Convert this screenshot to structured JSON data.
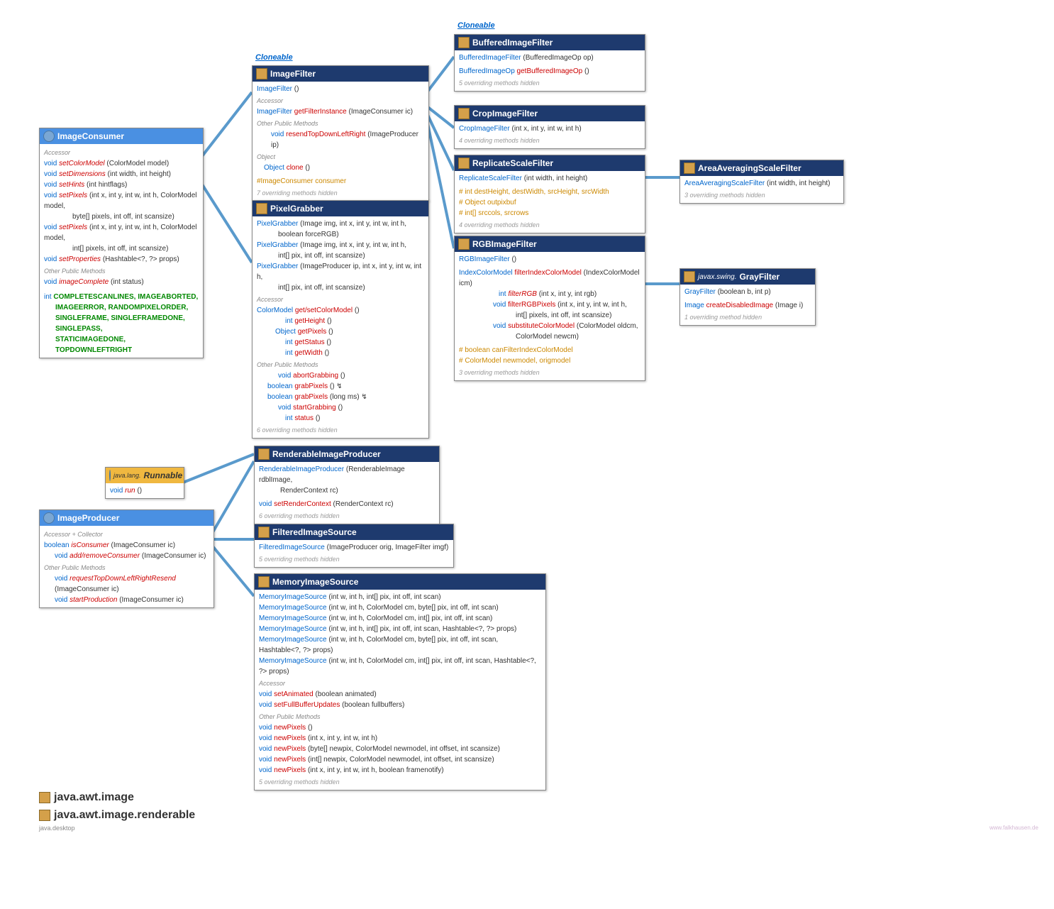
{
  "tags": {
    "cloneable1": "Cloneable",
    "cloneable2": "Cloneable"
  },
  "imageConsumer": {
    "title": "ImageConsumer",
    "sect1": "Accessor",
    "m1r": "void",
    "m1n": "setColorModel",
    "m1p": "(ColorModel model)",
    "m2r": "void",
    "m2n": "setDimensions",
    "m2p": "(int width, int height)",
    "m3r": "void",
    "m3n": "setHints",
    "m3p": "(int hintflags)",
    "m4r": "void",
    "m4n": "setPixels",
    "m4p": "(int x, int y, int w, int h, ColorModel model,",
    "m4p2": "byte[] pixels, int off, int scansize)",
    "m5r": "void",
    "m5n": "setPixels",
    "m5p": "(int x, int y, int w, int h, ColorModel model,",
    "m5p2": "int[] pixels, int off, int scansize)",
    "m6r": "void",
    "m6n": "setProperties",
    "m6p": "(Hashtable<?, ?> props)",
    "sect2": "Other Public Methods",
    "m7r": "void",
    "m7n": "imageComplete",
    "m7p": "(int status)",
    "constr": "int",
    "const1": "COMPLETESCANLINES, IMAGEABORTED,",
    "const2": "IMAGEERROR, RANDOMPIXELORDER,",
    "const3": "SINGLEFRAME, SINGLEFRAMEDONE, SINGLEPASS,",
    "const4": "STATICIMAGEDONE, TOPDOWNLEFTRIGHT"
  },
  "imageFilter": {
    "title": "ImageFilter",
    "c1": "ImageFilter",
    "c1p": "()",
    "s1": "Accessor",
    "m1r": "ImageFilter",
    "m1n": "getFilterInstance",
    "m1p": "(ImageConsumer ic)",
    "s2": "Other Public Methods",
    "m2r": "void",
    "m2n": "resendTopDownLeftRight",
    "m2p": "(ImageProducer ip)",
    "s3": "Object",
    "m3r": "Object",
    "m3n": "clone",
    "m3p": "()",
    "f1": "#ImageConsumer consumer",
    "h": "7 overriding methods hidden"
  },
  "pixelGrabber": {
    "title": "PixelGrabber",
    "c1": "PixelGrabber",
    "c1p": "(Image img, int x, int y, int w, int h,",
    "c1p2": "boolean forceRGB)",
    "c2": "PixelGrabber",
    "c2p": "(Image img, int x, int y, int w, int h,",
    "c2p2": "int[] pix, int off, int scansize)",
    "c3": "PixelGrabber",
    "c3p": "(ImageProducer ip, int x, int y, int w, int h,",
    "c3p2": "int[] pix, int off, int scansize)",
    "s1": "Accessor",
    "m1r": "ColorModel",
    "m1n": "get/setColorModel",
    "m1p": "()",
    "m2r": "int",
    "m2n": "getHeight",
    "m2p": "()",
    "m3r": "Object",
    "m3n": "getPixels",
    "m3p": "()",
    "m4r": "int",
    "m4n": "getStatus",
    "m4p": "()",
    "m5r": "int",
    "m5n": "getWidth",
    "m5p": "()",
    "s2": "Other Public Methods",
    "m6r": "void",
    "m6n": "abortGrabbing",
    "m6p": "()",
    "m7r": "boolean",
    "m7n": "grabPixels",
    "m7p": "() ↯",
    "m8r": "boolean",
    "m8n": "grabPixels",
    "m8p": "(long ms) ↯",
    "m9r": "void",
    "m9n": "startGrabbing",
    "m9p": "()",
    "m10r": "int",
    "m10n": "status",
    "m10p": "()",
    "h": "6 overriding methods hidden"
  },
  "bufferedImageFilter": {
    "title": "BufferedImageFilter",
    "c1": "BufferedImageFilter",
    "c1p": "(BufferedImageOp op)",
    "m1r": "BufferedImageOp",
    "m1n": "getBufferedImageOp",
    "m1p": "()",
    "h": "5 overriding methods hidden"
  },
  "cropImageFilter": {
    "title": "CropImageFilter",
    "c1": "CropImageFilter",
    "c1p": "(int x, int y, int w, int h)",
    "h": "4 overriding methods hidden"
  },
  "replicateScaleFilter": {
    "title": "ReplicateScaleFilter",
    "c1": "ReplicateScaleFilter",
    "c1p": "(int width, int height)",
    "f1": "# int destHeight, destWidth, srcHeight, srcWidth",
    "f2": "# Object outpixbuf",
    "f3": "# int[] srccols, srcrows",
    "h": "4 overriding methods hidden"
  },
  "areaAveragingScaleFilter": {
    "title": "AreaAveragingScaleFilter",
    "c1": "AreaAveragingScaleFilter",
    "c1p": "(int width, int height)",
    "h": "3 overriding methods hidden"
  },
  "rgbImageFilter": {
    "title": "RGBImageFilter",
    "c1": "RGBImageFilter",
    "c1p": "()",
    "m1r": "IndexColorModel",
    "m1n": "filterIndexColorModel",
    "m1p": "(IndexColorModel icm)",
    "m2r": "int",
    "m2n": "filterRGB",
    "m2p": "(int x, int y, int rgb)",
    "m3r": "void",
    "m3n": "filterRGBPixels",
    "m3p": "(int x, int y, int w, int h,",
    "m3p2": "int[] pixels, int off, int scansize)",
    "m4r": "void",
    "m4n": "substituteColorModel",
    "m4p": "(ColorModel oldcm,",
    "m4p2": "ColorModel newcm)",
    "f1": "# boolean canFilterIndexColorModel",
    "f2": "# ColorModel newmodel, origmodel",
    "h": "3 overriding methods hidden"
  },
  "grayFilter": {
    "pkg": "javax.swing.",
    "title": "GrayFilter",
    "c1": "GrayFilter",
    "c1p": "(boolean b, int p)",
    "m1r": "Image",
    "m1n": "createDisabledImage",
    "m1p": "(Image i)",
    "h": "1 overriding method hidden"
  },
  "runnable": {
    "pkg": "java.lang.",
    "title": "Runnable",
    "m1r": "void",
    "m1n": "run",
    "m1p": "()"
  },
  "imageProducer": {
    "title": "ImageProducer",
    "s1": "Accessor + Collector",
    "m1r": "boolean",
    "m1n": "isConsumer",
    "m1p": "(ImageConsumer ic)",
    "m2r": "void",
    "m2n": "add/removeConsumer",
    "m2p": "(ImageConsumer ic)",
    "s2": "Other Public Methods",
    "m3r": "void",
    "m3n": "requestTopDownLeftRightResend",
    "m3p": "(ImageConsumer ic)",
    "m4r": "void",
    "m4n": "startProduction",
    "m4p": "(ImageConsumer ic)"
  },
  "renderableImageProducer": {
    "title": "RenderableImageProducer",
    "c1": "RenderableImageProducer",
    "c1p": "(RenderableImage rdblImage,",
    "c1p2": "RenderContext rc)",
    "m1r": "void",
    "m1n": "setRenderContext",
    "m1p": "(RenderContext rc)",
    "h": "6 overriding methods hidden"
  },
  "filteredImageSource": {
    "title": "FilteredImageSource",
    "c1": "FilteredImageSource",
    "c1p": "(ImageProducer orig, ImageFilter imgf)",
    "h": "5 overriding methods hidden"
  },
  "memoryImageSource": {
    "title": "MemoryImageSource",
    "c1": "MemoryImageSource",
    "c1p": "(int w, int h, int[] pix, int off, int scan)",
    "c2": "MemoryImageSource",
    "c2p": "(int w, int h, ColorModel cm, byte[] pix, int off, int scan)",
    "c3": "MemoryImageSource",
    "c3p": "(int w, int h, ColorModel cm, int[] pix, int off, int scan)",
    "c4": "MemoryImageSource",
    "c4p": "(int w, int h, int[] pix, int off, int scan, Hashtable<?, ?> props)",
    "c5": "MemoryImageSource",
    "c5p": "(int w, int h, ColorModel cm, byte[] pix, int off, int scan, Hashtable<?, ?> props)",
    "c6": "MemoryImageSource",
    "c6p": "(int w, int h, ColorModel cm, int[] pix, int off, int scan, Hashtable<?, ?> props)",
    "s1": "Accessor",
    "m1r": "void",
    "m1n": "setAnimated",
    "m1p": "(boolean animated)",
    "m2r": "void",
    "m2n": "setFullBufferUpdates",
    "m2p": "(boolean fullbuffers)",
    "s2": "Other Public Methods",
    "m3r": "void",
    "m3n": "newPixels",
    "m3p": "()",
    "m4r": "void",
    "m4n": "newPixels",
    "m4p": "(int x, int y, int w, int h)",
    "m5r": "void",
    "m5n": "newPixels",
    "m5p": "(byte[] newpix, ColorModel newmodel, int offset, int scansize)",
    "m6r": "void",
    "m6n": "newPixels",
    "m6p": "(int[] newpix, ColorModel newmodel, int offset, int scansize)",
    "m7r": "void",
    "m7n": "newPixels",
    "m7p": "(int x, int y, int w, int h, boolean framenotify)",
    "h": "5 overriding methods hidden"
  },
  "footer": {
    "p1": "java.awt.image",
    "p2": "java.awt.image.renderable",
    "mod": "java.desktop",
    "wm": "www.falkhausen.de"
  }
}
